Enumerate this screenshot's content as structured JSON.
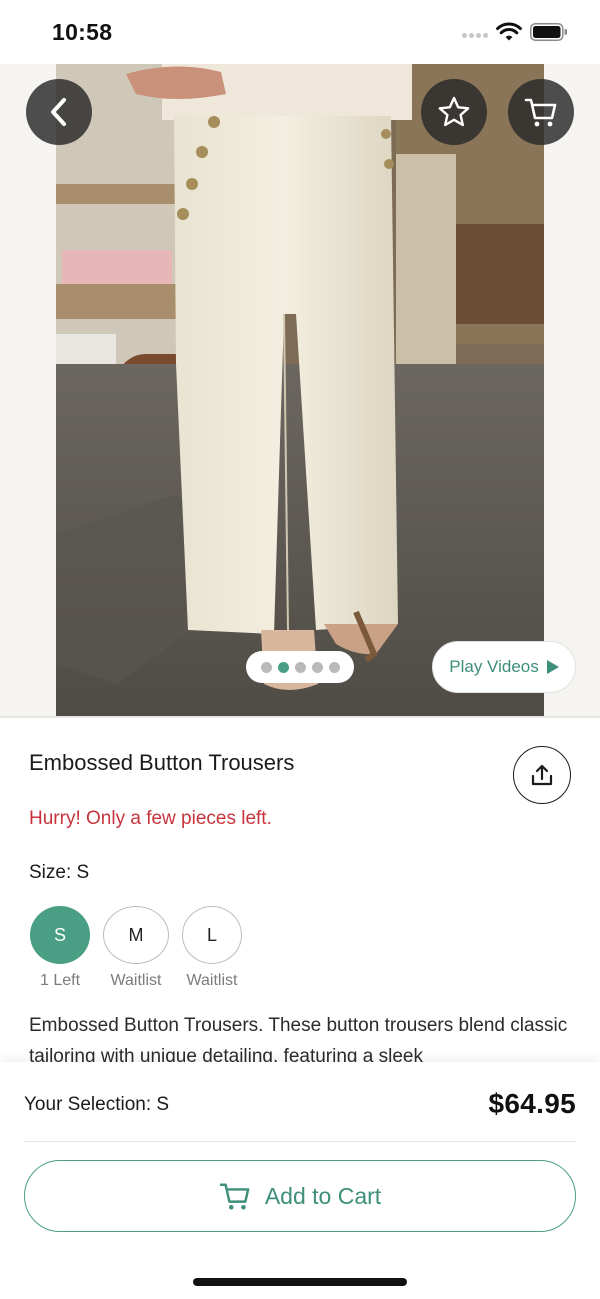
{
  "status_bar": {
    "time": "10:58"
  },
  "icons": {
    "back": "chevron-left-icon",
    "favorite": "star-icon",
    "cart": "cart-icon",
    "share": "share-icon",
    "play": "play-icon",
    "add_to_cart": "cart-icon"
  },
  "gallery": {
    "image_count": 5,
    "active_index": 1,
    "play_videos_label": "Play Videos"
  },
  "product": {
    "title": "Embossed Button Trousers",
    "stock_message": "Hurry! Only a few pieces left.",
    "size_label": "Size: S",
    "sizes": [
      {
        "label": "S",
        "availability": "1 Left",
        "selected": true
      },
      {
        "label": "M",
        "availability": "Waitlist",
        "selected": false
      },
      {
        "label": "L",
        "availability": "Waitlist",
        "selected": false
      }
    ],
    "description": "Embossed Button Trousers. These button trousers blend classic tailoring with unique detailing, featuring a sleek"
  },
  "footer": {
    "selection_text": "Your Selection: S",
    "price": "$64.95",
    "add_to_cart_label": "Add to Cart"
  },
  "colors": {
    "accent": "#4a9e84",
    "alert": "#c8343d",
    "text": "#1b1b1b"
  }
}
